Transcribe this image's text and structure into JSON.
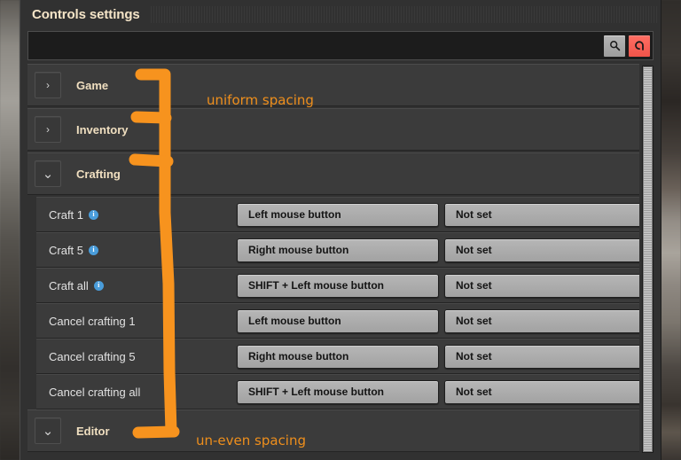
{
  "window": {
    "title": "Controls settings"
  },
  "search": {
    "value": "",
    "placeholder": "",
    "search_button_icon": "search-icon",
    "reset_button_icon": "reset-icon",
    "reset_button_color": "#f2544a"
  },
  "icons": {
    "chevron_collapsed": "›",
    "chevron_expanded": "⌄",
    "info": "i"
  },
  "groups": [
    {
      "label": "Game",
      "expanded": false,
      "rows": []
    },
    {
      "label": "Inventory",
      "expanded": false,
      "rows": []
    },
    {
      "label": "Crafting",
      "expanded": true,
      "rows": [
        {
          "label": "Craft 1",
          "has_info": true,
          "primary": "Left mouse button",
          "secondary": "Not set"
        },
        {
          "label": "Craft 5",
          "has_info": true,
          "primary": "Right mouse button",
          "secondary": "Not set"
        },
        {
          "label": "Craft all",
          "has_info": true,
          "primary": "SHIFT + Left mouse button",
          "secondary": "Not set"
        },
        {
          "label": "Cancel crafting 1",
          "has_info": false,
          "primary": "Left mouse button",
          "secondary": "Not set"
        },
        {
          "label": "Cancel crafting 5",
          "has_info": false,
          "primary": "Right mouse button",
          "secondary": "Not set"
        },
        {
          "label": "Cancel crafting all",
          "has_info": false,
          "primary": "SHIFT + Left mouse button",
          "secondary": "Not set"
        }
      ]
    },
    {
      "label": "Editor",
      "expanded": true,
      "rows": []
    }
  ],
  "annotations": {
    "color": "#f7931e",
    "uniform_spacing_label": "uniform spacing",
    "uneven_spacing_label": "un-even spacing"
  },
  "scrollbar": {
    "orientation": "vertical"
  }
}
